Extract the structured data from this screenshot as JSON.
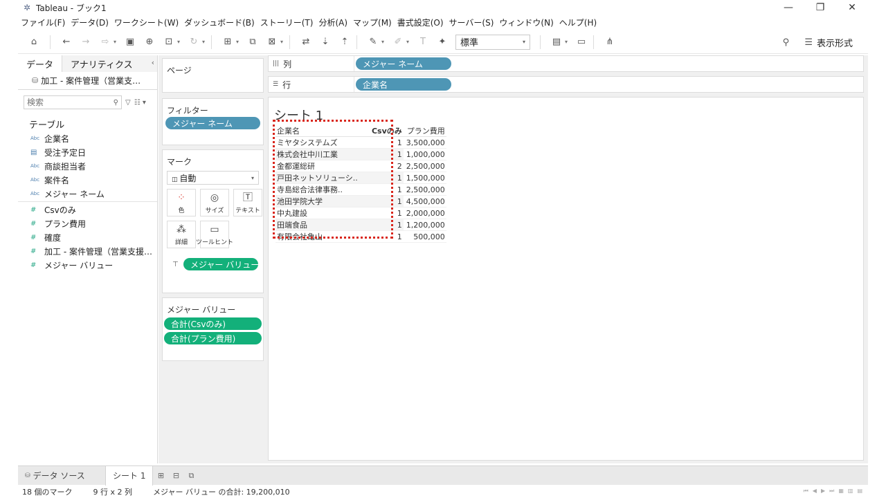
{
  "window": {
    "title": "Tableau - ブック1",
    "minimize": "—",
    "restore": "❐",
    "close": "✕"
  },
  "menu": [
    "ファイル(F)",
    "データ(D)",
    "ワークシート(W)",
    "ダッシュボード(B)",
    "ストーリー(T)",
    "分析(A)",
    "マップ(M)",
    "書式設定(O)",
    "サーバー(S)",
    "ウィンドウ(N)",
    "ヘルプ(H)"
  ],
  "toolbar": {
    "fit_value": "標準",
    "show_me_label": "表示形式"
  },
  "data_pane": {
    "tabs": [
      "データ",
      "アナリティクス"
    ],
    "datasource": "加工 - 案件管理（営業支…",
    "search_placeholder": "検索",
    "table_heading": "テーブル",
    "dimensions": [
      {
        "type": "Abc",
        "name": "企業名"
      },
      {
        "type": "date",
        "name": "受注予定日"
      },
      {
        "type": "Abc",
        "name": "商談担当者"
      },
      {
        "type": "Abc",
        "name": "案件名"
      },
      {
        "type": "Abc",
        "name": "メジャー ネーム"
      }
    ],
    "measures": [
      {
        "type": "#",
        "name": "Csvのみ"
      },
      {
        "type": "#",
        "name": "プラン費用"
      },
      {
        "type": "#",
        "name": "確度"
      },
      {
        "type": "#",
        "name": "加工 - 案件管理（営業支援…"
      },
      {
        "type": "#",
        "name": "メジャー バリュー"
      }
    ]
  },
  "cards": {
    "pages_title": "ページ",
    "filters_title": "フィルター",
    "filters_pill": "メジャー ネーム",
    "marks_title": "マーク",
    "marks_type": "自動",
    "mark_buttons": [
      "色",
      "サイズ",
      "テキスト",
      "詳細",
      "ツールヒント"
    ],
    "marks_pill": "メジャー バリュー",
    "measure_values_title": "メジャー バリュー",
    "measure_values_pills": [
      "合計(Csvのみ)",
      "合計(プラン費用)"
    ]
  },
  "shelves": {
    "columns_label": "列",
    "columns_pill": "メジャー ネーム",
    "rows_label": "行",
    "rows_pill": "企業名"
  },
  "view": {
    "sheet_title": "シート 1",
    "headers": [
      "企業名",
      "Csvのみ",
      "プラン費用"
    ],
    "rows": [
      [
        "ミヤタシステムズ",
        "1",
        "3,500,000"
      ],
      [
        "株式会社中川工業",
        "1",
        "1,000,000"
      ],
      [
        "金都運総研",
        "2",
        "2,500,000"
      ],
      [
        "戸田ネットソリューシ..",
        "1",
        "1,500,000"
      ],
      [
        "寺島総合法律事務..",
        "1",
        "2,500,000"
      ],
      [
        "池田学院大学",
        "1",
        "4,500,000"
      ],
      [
        "中丸建設",
        "1",
        "2,000,000"
      ],
      [
        "田端食品",
        "1",
        "1,200,000"
      ],
      [
        "有限会社亀山",
        "1",
        "500,000"
      ]
    ]
  },
  "bottom_tabs": {
    "datasource": "データ ソース",
    "sheet": "シート 1"
  },
  "status": {
    "marks": "18 個のマーク",
    "dims": "9 行 x 2 列",
    "sum": "メジャー バリュー の合計: 19,200,010"
  }
}
